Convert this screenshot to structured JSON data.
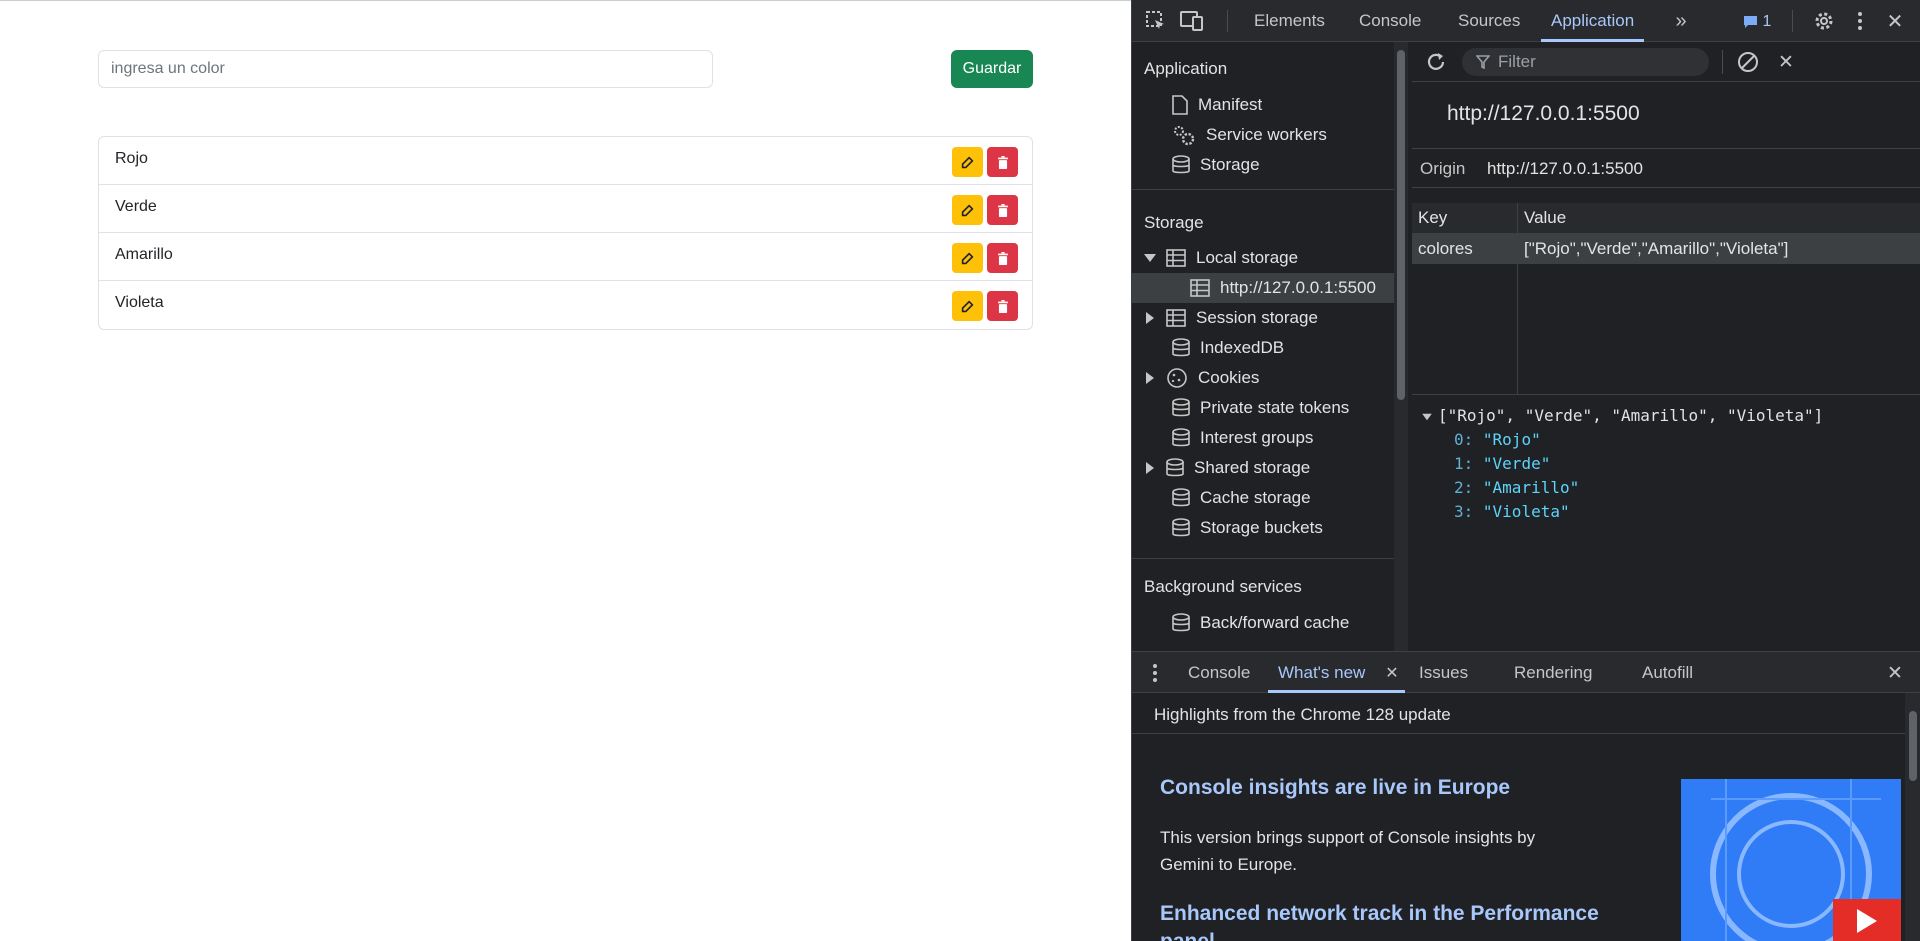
{
  "page": {
    "input_placeholder": "ingresa un color",
    "save_label": "Guardar",
    "colors": [
      "Rojo",
      "Verde",
      "Amarillo",
      "Violeta"
    ]
  },
  "devtools": {
    "tabs": [
      "Elements",
      "Console",
      "Sources",
      "Application"
    ],
    "active_tab": "Application",
    "issues_count": "1",
    "sidebar": {
      "application_header": "Application",
      "application_items": [
        "Manifest",
        "Service workers",
        "Storage"
      ],
      "storage_header": "Storage",
      "storage_items": {
        "local_storage": "Local storage",
        "local_origin": "http://127.0.0.1:5500",
        "session_storage": "Session storage",
        "indexeddb": "IndexedDB",
        "cookies": "Cookies",
        "private_state_tokens": "Private state tokens",
        "interest_groups": "Interest groups",
        "shared_storage": "Shared storage",
        "cache_storage": "Cache storage",
        "storage_buckets": "Storage buckets"
      },
      "background_header": "Background services",
      "background_items": [
        "Back/forward cache"
      ]
    },
    "main": {
      "filter_placeholder": "Filter",
      "origin_title": "http://127.0.0.1:5500",
      "origin_label": "Origin",
      "origin_value": "http://127.0.0.1:5500",
      "table_headers": [
        "Key",
        "Value"
      ],
      "rows": [
        {
          "key": "colores",
          "value": "[\"Rojo\",\"Verde\",\"Amarillo\",\"Violeta\"]"
        }
      ],
      "preview_summary": "[\"Rojo\", \"Verde\", \"Amarillo\", \"Violeta\"]",
      "preview_items": [
        {
          "index": "0",
          "value": "\"Rojo\""
        },
        {
          "index": "1",
          "value": "\"Verde\""
        },
        {
          "index": "2",
          "value": "\"Amarillo\""
        },
        {
          "index": "3",
          "value": "\"Violeta\""
        }
      ]
    },
    "drawer": {
      "tabs": [
        "Console",
        "What's new",
        "Issues",
        "Rendering",
        "Autofill"
      ],
      "active_tab": "What's new",
      "highlights": "Highlights from the Chrome 128 update",
      "article1_title": "Console insights are live in Europe",
      "article1_body": "This version brings support of Console insights by Gemini to Europe.",
      "article2_title": "Enhanced network track in the Performance panel"
    }
  },
  "colors": {
    "save": "#198754",
    "edit": "#ffc107",
    "delete": "#dc3545",
    "accent": "#a8c7fa"
  }
}
